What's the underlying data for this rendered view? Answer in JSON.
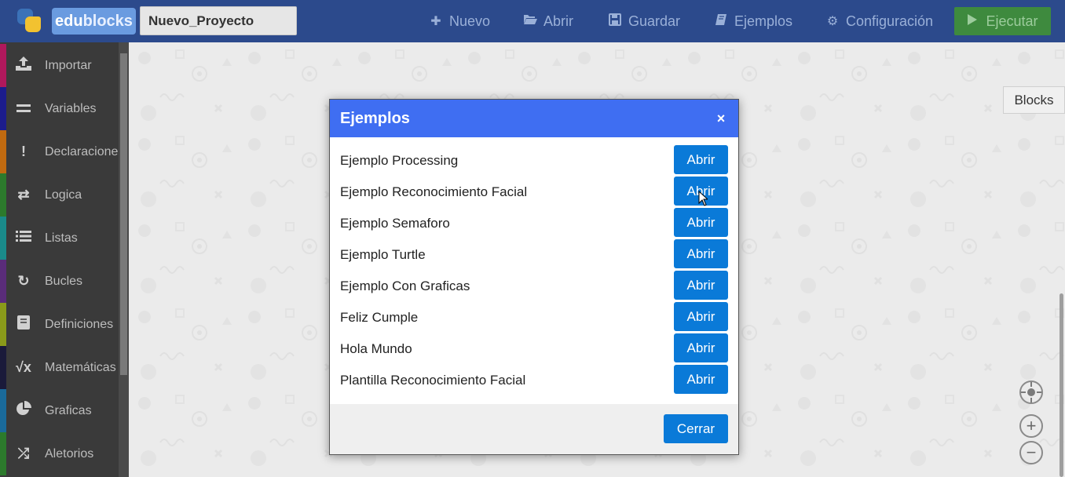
{
  "topbar": {
    "logo_text_edu": "edu",
    "logo_text_blocks": "blocks",
    "project_name": "Nuevo_Proyecto",
    "nav": {
      "nuevo": "Nuevo",
      "abrir": "Abrir",
      "guardar": "Guardar",
      "ejemplos": "Ejemplos",
      "configuracion": "Configuración"
    },
    "run_label": "Ejecutar",
    "run_color": "#3e8a3e",
    "bar_color": "#2c4a8c"
  },
  "sidebar": {
    "items": [
      {
        "label": "Importar",
        "icon": "upload-icon",
        "color": "#b0185c"
      },
      {
        "label": "Variables",
        "icon": "equals-icon",
        "color": "#1c1c8c"
      },
      {
        "label": "Declaraciones",
        "icon": "exclamation-icon",
        "color": "#c06a10"
      },
      {
        "label": "Logica",
        "icon": "swap-arrows-icon",
        "color": "#2c7a2c"
      },
      {
        "label": "Listas",
        "icon": "list-icon",
        "color": "#1a8a8a"
      },
      {
        "label": "Bucles",
        "icon": "loop-icon",
        "color": "#5a2c7a"
      },
      {
        "label": "Definiciones",
        "icon": "book-icon",
        "color": "#8a9a1a"
      },
      {
        "label": "Matemáticas",
        "icon": "sqrt-x-icon",
        "color": "#1a1a3a"
      },
      {
        "label": "Graficas",
        "icon": "pie-chart-icon",
        "color": "#1a6a9a"
      },
      {
        "label": "Aletorios",
        "icon": "shuffle-icon",
        "color": "#2c7a2c"
      }
    ]
  },
  "workspace": {
    "tab_label": "Blocks"
  },
  "modal": {
    "title": "Ejemplos",
    "close_symbol": "×",
    "header_color": "#3f6ef2",
    "examples": [
      {
        "name": "Ejemplo Processing",
        "button": "Abrir"
      },
      {
        "name": "Ejemplo Reconocimiento Facial",
        "button": "Abrir"
      },
      {
        "name": "Ejemplo Semaforo",
        "button": "Abrir"
      },
      {
        "name": "Ejemplo Turtle",
        "button": "Abrir"
      },
      {
        "name": "Ejemplo Con Graficas",
        "button": "Abrir"
      },
      {
        "name": "Feliz Cumple",
        "button": "Abrir"
      },
      {
        "name": "Hola Mundo",
        "button": "Abrir"
      },
      {
        "name": "Plantilla Reconocimiento Facial",
        "button": "Abrir"
      }
    ],
    "close_button": "Cerrar",
    "button_color": "#0a7ad8"
  }
}
